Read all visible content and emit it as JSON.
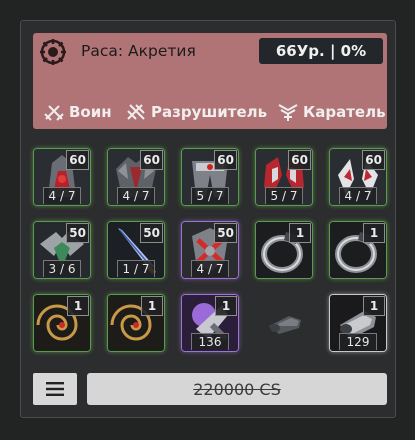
{
  "race": {
    "label": "Раса: Акретия",
    "level": "66Ур. | 0%",
    "icon": "accretia-race-icon"
  },
  "classes": [
    {
      "name": "Воин",
      "icon": "warrior-class-icon"
    },
    {
      "name": "Разрушитель",
      "icon": "destroyer-class-icon"
    },
    {
      "name": "Каратель",
      "icon": "punisher-class-icon"
    }
  ],
  "items": [
    {
      "name": "helmet-item",
      "level": "60",
      "count": "4 / 7"
    },
    {
      "name": "armor-item",
      "level": "60",
      "count": "4 / 7"
    },
    {
      "name": "pants-item",
      "level": "60",
      "count": "5 / 7"
    },
    {
      "name": "gloves-item",
      "level": "60",
      "count": "5 / 7"
    },
    {
      "name": "boots-item",
      "level": "60",
      "count": "4 / 7"
    },
    {
      "name": "shoulder-item",
      "level": "50",
      "count": "3 / 6"
    },
    {
      "name": "sword-item",
      "level": "50",
      "count": "1 / 7"
    },
    {
      "name": "shield-item",
      "level": "50",
      "count": "4 / 7"
    },
    {
      "name": "ring-item-1",
      "level": "1",
      "count": ""
    },
    {
      "name": "ring-item-2",
      "level": "1",
      "count": ""
    },
    {
      "name": "amulet-item-1",
      "level": "1",
      "count": ""
    },
    {
      "name": "amulet-item-2",
      "level": "1",
      "count": ""
    },
    {
      "name": "force-item",
      "level": "1",
      "count": "136"
    },
    {
      "name": "capsule-item",
      "level": "",
      "count": ""
    },
    {
      "name": "battery-item",
      "level": "1",
      "count": "129"
    }
  ],
  "footer": {
    "menu_icon": "menu-icon",
    "price": "220000 CS"
  }
}
